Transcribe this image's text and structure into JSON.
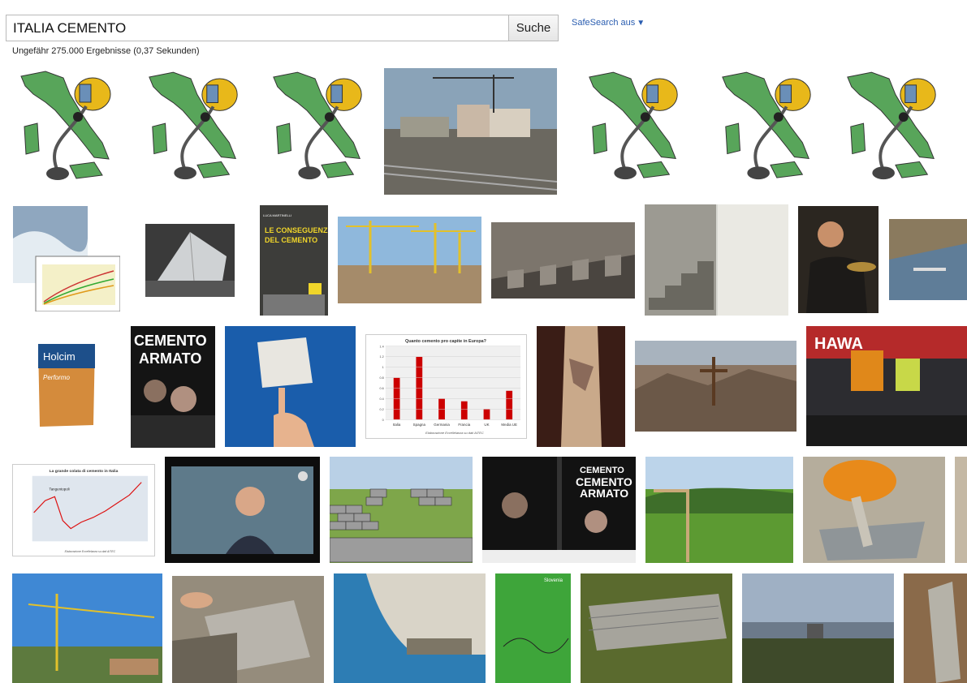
{
  "search": {
    "query": "ITALIA CEMENTO",
    "button_label": "Suche",
    "safesearch_label": "SafeSearch aus",
    "safesearch_arrow": "▼"
  },
  "results_info": "Ungefähr 275.000 Ergebnisse (0,37 Sekunden)",
  "thumbnails": {
    "book_title": "LE CONSEGUENZE DEL CEMENTO",
    "book_author": "LUCA MARTINELLI",
    "bag_brand": "Holcim",
    "bag_product": "Performo",
    "movie_title_1": "CEMENTO",
    "movie_title_2": "ARMATO",
    "chart_title": "Quanto cemento pro capite in Europa?",
    "chart_source": "Elaborazione Eccellelanza su dati AITEC",
    "line_chart_title": "La grande colata di cemento in Italia",
    "line_chart_annotation": "Tangentopoli",
    "line_chart_source": "Elaborazione Eccellelanza su dati AITEC",
    "map_label": "Slovenia",
    "stage_banner": "HAWA"
  },
  "chart_data": {
    "type": "bar",
    "title": "Quanto cemento pro capite in Europa?",
    "categories": [
      "Italia",
      "Spagna",
      "Germania",
      "Francia",
      "UK",
      "Media UE"
    ],
    "values": [
      0.8,
      1.2,
      0.4,
      0.35,
      0.2,
      0.55
    ],
    "ylim": [
      0,
      1.4
    ],
    "yticks": [
      "0",
      "0.2",
      "0.4",
      "0.6",
      "0.8",
      "1",
      "1.2",
      "1.4"
    ],
    "color": "#cc0000"
  }
}
